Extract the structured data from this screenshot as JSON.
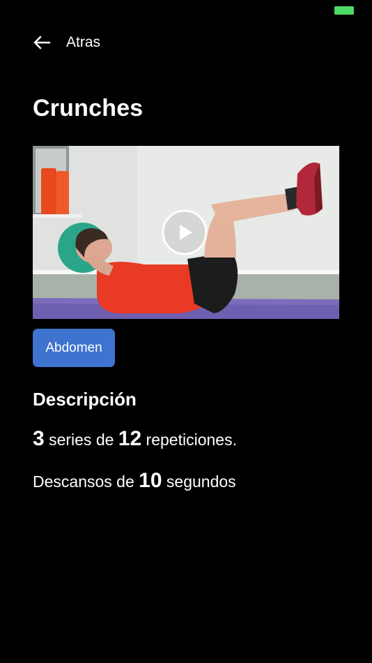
{
  "status_bar": {
    "battery_color": "#4cd964"
  },
  "nav": {
    "back_icon": "arrow-left-icon",
    "back_label": "Atras"
  },
  "exercise": {
    "title": "Crunches",
    "video": {
      "play_icon": "play-circle-icon"
    },
    "category": "Abdomen",
    "category_color": "#3e73cf"
  },
  "description": {
    "heading": "Descripción",
    "sets": "3",
    "sets_text": " series de ",
    "reps": "12",
    "reps_text": " repeticiones.",
    "rest_prefix": "Descansos de ",
    "rest": "10",
    "rest_suffix": " segundos"
  }
}
